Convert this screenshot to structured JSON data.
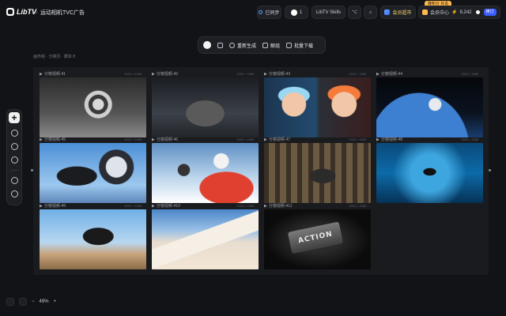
{
  "app": {
    "logo_text": "LibTV",
    "project_title": "运动相机TVC广告"
  },
  "header": {
    "sync_status": "已同步",
    "user_count": "1",
    "skills_label": "LibTV Skills",
    "vip_label": "会员超市",
    "credit_badge": "赚积分 好友",
    "member_center": "会员中心",
    "credits": "9,242",
    "subscribe_label": "续订"
  },
  "toolbar": {
    "regenerate": "重新生成",
    "unlink": "解组",
    "batch_download": "批量下载"
  },
  "breadcrumb": "画布组 · 分镜页 · 脚本 8",
  "cells": [
    {
      "label": "分镜视频-41",
      "size": "1920 × 1080",
      "scene": "lens-sand"
    },
    {
      "label": "分镜视频-42",
      "size": "1920 × 1080",
      "scene": "camera-rock"
    },
    {
      "label": "分镜视频-43",
      "size": "1920 × 1080",
      "scene": "goggle-faces"
    },
    {
      "label": "分镜视频-44",
      "size": "1920 × 1080",
      "scene": "space-astronaut"
    },
    {
      "label": "分镜视频-45",
      "size": "1920 × 1080",
      "scene": "skydiver-camera"
    },
    {
      "label": "分镜视频-46",
      "size": "1920 × 1080",
      "scene": "ski-selfie"
    },
    {
      "label": "分镜视频-47",
      "size": "1920 × 1080",
      "scene": "forest-biker"
    },
    {
      "label": "分镜视频-48",
      "size": "1920 × 1080",
      "scene": "underwater-diver"
    },
    {
      "label": "分镜视频-49",
      "size": "1920 × 1080",
      "scene": "mtb-jump"
    },
    {
      "label": "分镜视频-410",
      "size": "1920 × 1080",
      "scene": "snow-mountain"
    },
    {
      "label": "分镜视频-411",
      "size": "1920 × 1080",
      "scene": "action-logo",
      "overlay_text": "ACTION"
    }
  ],
  "bottom": {
    "zoom": "49%"
  },
  "colors": {
    "accent": "#3b5cff",
    "canvas": "#121316",
    "panel": "#1a1b1e"
  }
}
